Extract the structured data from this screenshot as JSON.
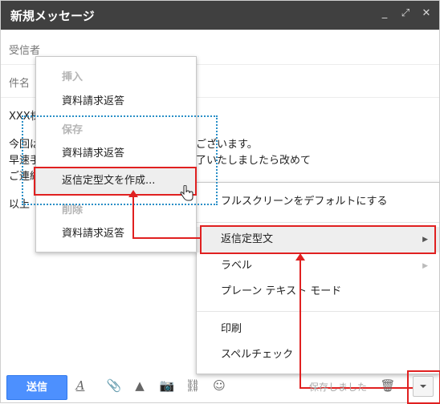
{
  "window": {
    "title": "新規メッセージ"
  },
  "fields": {
    "to_label": "受信者",
    "subject_label": "件名"
  },
  "message_lines": [
    "XXX様",
    "今回は",
    "ございます。",
    "早速手",
    "了いたしましたら改めて",
    "ご連絡",
    "以上"
  ],
  "templates_menu": {
    "insert_header": "挿入",
    "insert_item": "資料請求返答",
    "save_header": "保存",
    "save_item": "資料請求返答",
    "create_item": "返信定型文を作成...",
    "delete_header": "削除",
    "delete_item": "資料請求返答"
  },
  "more_menu": {
    "fullscreen": "フルスクリーンをデフォルトにする",
    "canned": "返信定型文",
    "label": "ラベル",
    "plaintext": "プレーン テキスト モード",
    "print": "印刷",
    "spellcheck": "スペルチェック"
  },
  "toolbar": {
    "send_label": "送信",
    "saved_status": "保存しました"
  },
  "colors": {
    "titlebar": "#404040",
    "send": "#4d90fe",
    "annotation_red": "#e02020",
    "annotation_blue": "#2a8fc7"
  }
}
